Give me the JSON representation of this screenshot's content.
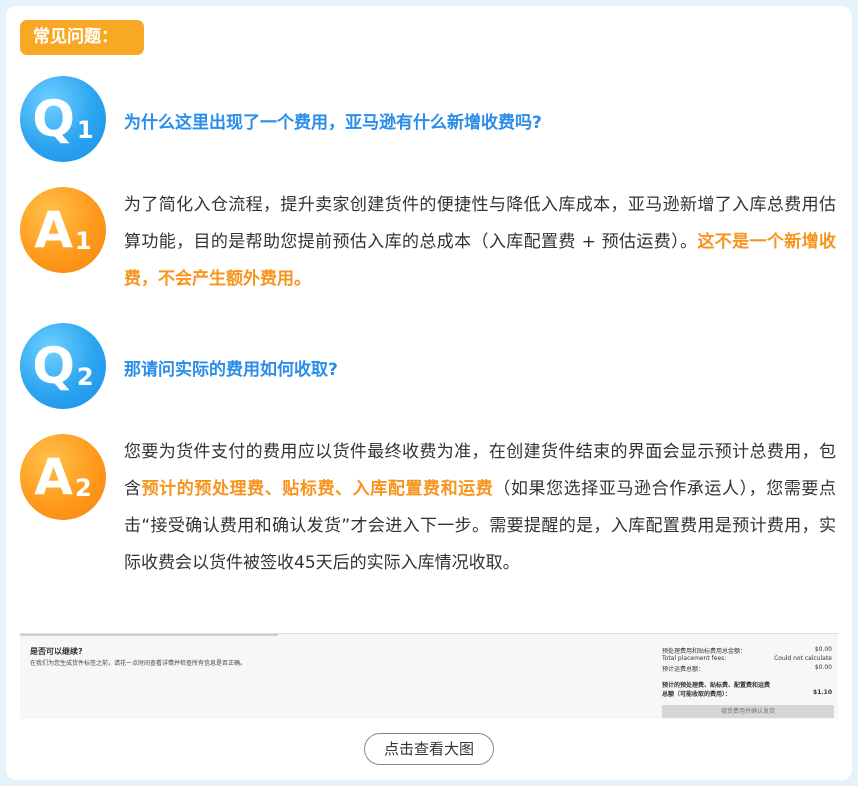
{
  "section_title": "常见问题：",
  "faq": [
    {
      "q_badge": {
        "letter": "Q",
        "number": "1"
      },
      "question": "为什么这里出现了一个费用，亚马逊有什么新增收费吗?",
      "a_badge": {
        "letter": "A",
        "number": "1"
      },
      "answer_part1": "为了简化入仓流程，提升卖家创建货件的便捷性与降低入库成本，亚马逊新增了入库总费用估算功能，目的是帮助您提前预估入库的总成本（入库配置费 + 预估运费）。",
      "answer_highlight": "这不是一个新增收费，不会产生额外费用。",
      "answer_part2": ""
    },
    {
      "q_badge": {
        "letter": "Q",
        "number": "2"
      },
      "question": "那请问实际的费用如何收取?",
      "a_badge": {
        "letter": "A",
        "number": "2"
      },
      "answer_part1": "您要为货件支付的费用应以货件最终收费为准，在创建货件结束的界面会显示预计总费用，包含",
      "answer_highlight": "预计的预处理费、贴标费、入库配置费和运费",
      "answer_part2": "（如果您选择亚马逊合作承运人），您需要点击“接受确认费用和确认发货”才会进入下一步。需要提醒的是，入库配置费用是预计费用，实际收费会以货件被签收45天后的实际入库情况收取。"
    }
  ],
  "screenshot": {
    "title": "是否可以继续?",
    "subtitle": "在我们为您生成货件标签之前，请花一点时间查看详情并检查所有信息是否正确。",
    "rows": [
      {
        "label": "预处理费用和贴标费用总金额：",
        "value": "$0.00"
      },
      {
        "label": "Total placement fees:",
        "value": "Could not calculate"
      },
      {
        "label": "预计运费总额：",
        "value": "$0.00"
      },
      {
        "label": "预计的预处理费、贴标费、配置费和运费",
        "value": ""
      },
      {
        "label": "总额（可能收取的费用）：",
        "value": "$1.10"
      }
    ],
    "button": "接受费用并确认发货"
  },
  "view_button": "点击查看大图",
  "colors": {
    "question_blue": "#2a8de9",
    "highlight_orange": "#f7941d",
    "tag_orange": "#f9a825",
    "background": "#e6f3fb"
  }
}
